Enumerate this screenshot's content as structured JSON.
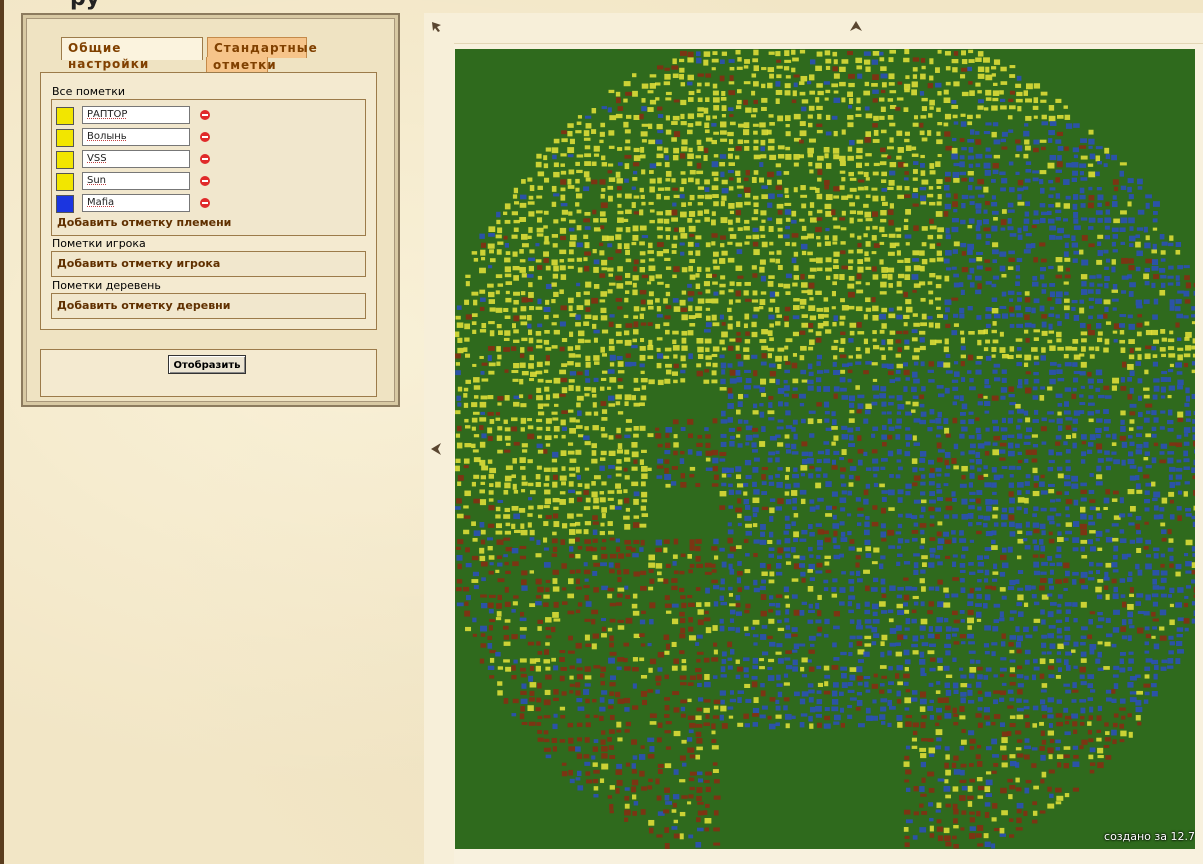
{
  "header": {
    "title_fragment": "ру"
  },
  "tabs": {
    "general_label": "Общие настройки",
    "standard_label_line1": "Стандартные",
    "standard_label_line2": "отметки"
  },
  "all_markers": {
    "label": "Все пометки",
    "tribes": [
      {
        "name": "РАПТОР",
        "color": "#f2e600"
      },
      {
        "name": "Волынь",
        "color": "#f2e600"
      },
      {
        "name": "VSS",
        "color": "#f2e600"
      },
      {
        "name": "Sun",
        "color": "#f2e600"
      },
      {
        "name": "Mafia",
        "color": "#1b35e0"
      }
    ],
    "add_tribe_label": "Добавить отметку племени"
  },
  "player_markers": {
    "label": "Пометки игрока",
    "add_label": "Добавить отметку игрока"
  },
  "village_markers": {
    "label": "Пометки деревень",
    "add_label": "Добавить отметку деревни"
  },
  "display_button_label": "Отобразить",
  "map": {
    "creation_time_label": "создано за 12.7",
    "colors": {
      "background": "#2f6a1d",
      "yellow": "#e8e43a",
      "blue": "#2a4fc0",
      "red": "#8a2a12"
    }
  }
}
